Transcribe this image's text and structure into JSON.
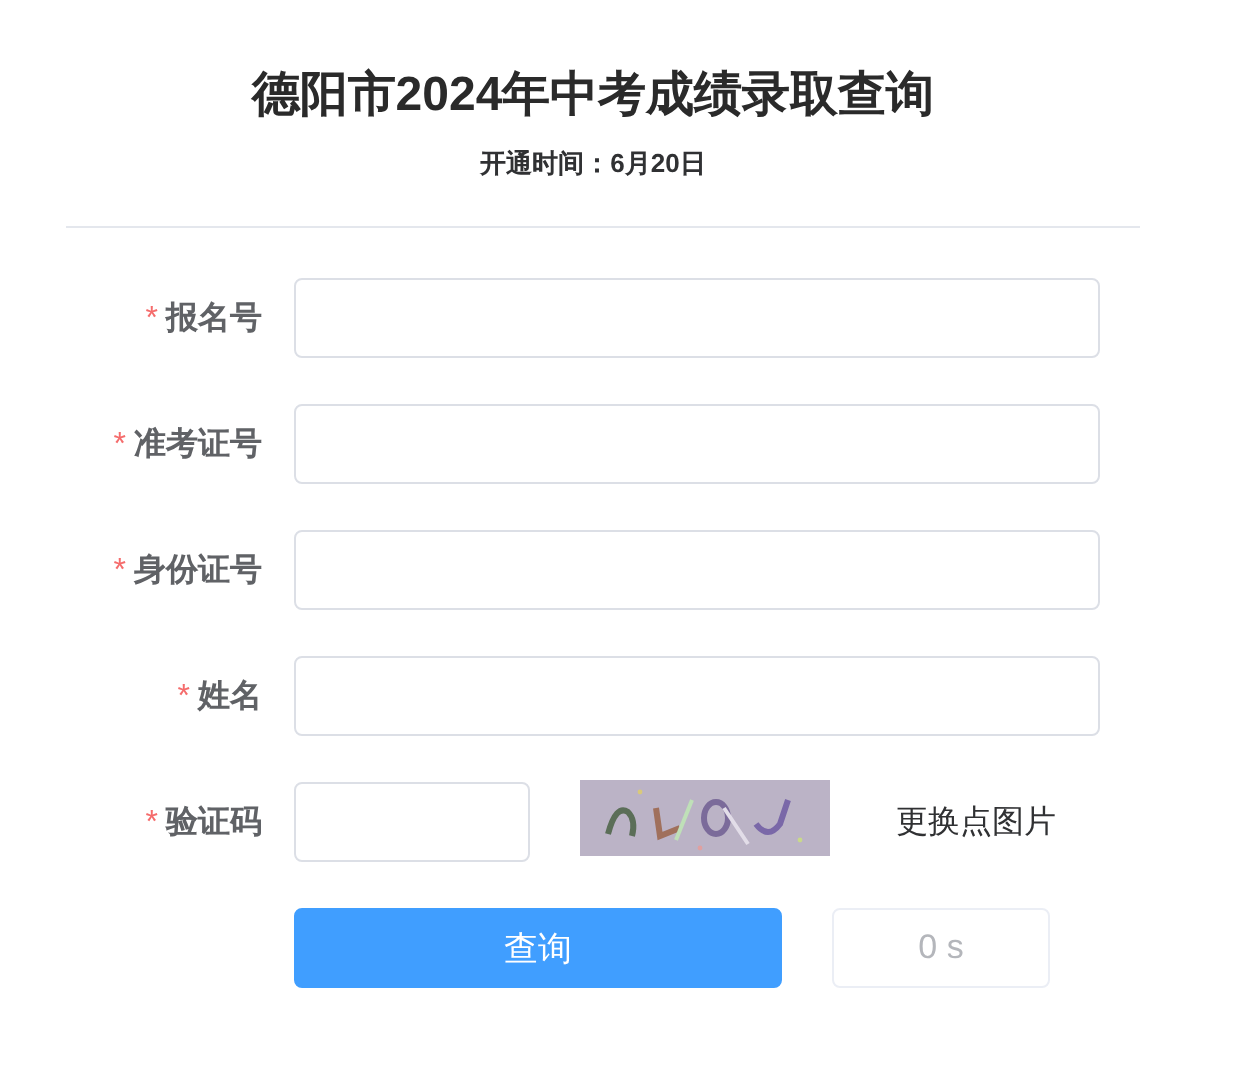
{
  "title": "德阳市2024年中考成绩录取查询",
  "subtitle": "开通时间：6月20日",
  "fields": [
    {
      "label": "报名号",
      "required": true,
      "kind": "text"
    },
    {
      "label": "准考证号",
      "required": true,
      "kind": "text"
    },
    {
      "label": "身份证号",
      "required": true,
      "kind": "text"
    },
    {
      "label": "姓名",
      "required": true,
      "kind": "text"
    },
    {
      "label": "验证码",
      "required": true,
      "kind": "captcha",
      "refresh_link": "更换点图片"
    }
  ],
  "required_mark": "*",
  "buttons": [
    {
      "label": "查询",
      "kind": "primary",
      "disabled": false
    },
    {
      "label": "0 s",
      "kind": "plain",
      "disabled": true
    }
  ]
}
